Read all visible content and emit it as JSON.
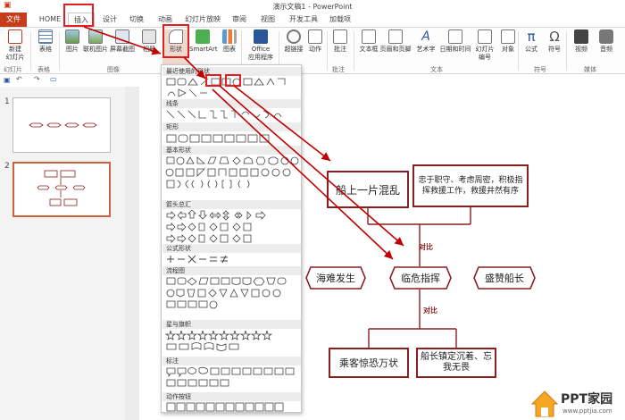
{
  "window": {
    "title": "演示文稿1 - PowerPoint"
  },
  "tabs": [
    "文件",
    "HOME",
    "插入",
    "设计",
    "切换",
    "动画",
    "幻灯片放映",
    "审阅",
    "视图",
    "开发工具",
    "加载项"
  ],
  "ribbon": {
    "buttons": [
      "新建\n幻灯片",
      "表格",
      "图片",
      "联机图片",
      "屏幕截图",
      "相册",
      "形状",
      "SmartArt",
      "图表",
      "Office\n应用程序",
      "超链接",
      "动作",
      "批注",
      "文本框",
      "页眉和页脚",
      "艺术字",
      "日期和时间",
      "幻灯片\n编号",
      "对象",
      "公式",
      "符号",
      "视频",
      "音频"
    ],
    "groups": [
      "幻灯片",
      "表格",
      "图像",
      "批注",
      "文本",
      "符号",
      "媒体"
    ]
  },
  "thumbnails": {
    "numbers": [
      "1",
      "2"
    ]
  },
  "shapes_panel": {
    "sections": [
      "最近使用的形状",
      "线条",
      "矩形",
      "基本形状",
      "箭头总汇",
      "公式形状",
      "流程图",
      "星与旗帜",
      "标注",
      "动作按钮"
    ]
  },
  "diagram": {
    "box_chaos": "船上一片混乱",
    "box_duty": "忠于职守、考虑周密，积极指挥救援工作，救援井然有序",
    "contrast_1": "对比",
    "contrast_2": "对比",
    "hex_disaster": "海难发生",
    "hex_command": "临危指挥",
    "hex_praise": "盛赞船长",
    "box_passengers": "乘客惊恐万状",
    "box_captain": "船长镇定沉着、忘我无畏"
  },
  "watermark": {
    "brand": "PPT家园",
    "url": "www.pptjia.com"
  },
  "colors": {
    "accent": "#c43e1c",
    "diagram_border": "#8b1e1e",
    "annotation": "#e02020"
  }
}
